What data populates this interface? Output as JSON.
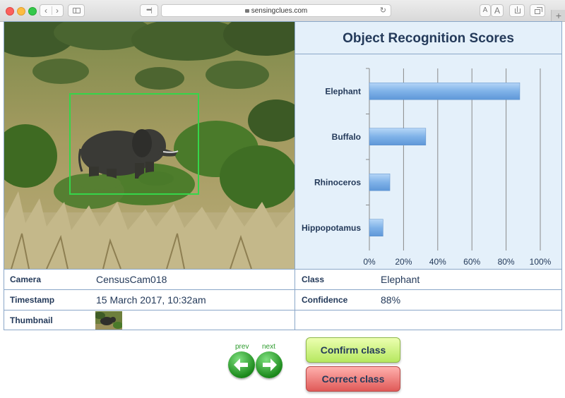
{
  "browser": {
    "url": "sensingclues.com",
    "reader_button": "•••|",
    "font_small": "A",
    "font_large": "A",
    "back_glyph": "‹",
    "forward_glyph": "›",
    "reload_glyph": "↻",
    "new_tab_glyph": "+"
  },
  "photo": {
    "subject": "elephant",
    "detection_box_color": "#35d54a"
  },
  "chart_data": {
    "type": "bar",
    "orientation": "horizontal",
    "title": "Object Recognition Scores",
    "categories": [
      "Elephant",
      "Buffalo",
      "Rhinoceros",
      "Hippopotamus"
    ],
    "values": [
      88,
      33,
      12,
      8
    ],
    "unit": "%",
    "xlim": [
      0,
      100
    ],
    "x_ticks": [
      "0%",
      "20%",
      "40%",
      "60%",
      "80%",
      "100%"
    ],
    "grid": true,
    "bar_color": "#7fb2e8"
  },
  "info": {
    "camera_label": "Camera",
    "camera_value": "CensusCam018",
    "timestamp_label": "Timestamp",
    "timestamp_value": "15 March 2017, 10:32am",
    "thumbnail_label": "Thumbnail",
    "class_label": "Class",
    "class_value": "Elephant",
    "confidence_label": "Confidence",
    "confidence_value": "88%"
  },
  "navigation": {
    "prev_label": "prev",
    "next_label": "next"
  },
  "actions": {
    "confirm_label": "Confirm class",
    "correct_label": "Correct class"
  },
  "colors": {
    "text": "#243a5a",
    "chart_bg": "#e4f0fa",
    "border": "#8aa7c8",
    "confirm": "#b6e860",
    "correct": "#e05a58",
    "nav_green": "#1c8a1c"
  }
}
